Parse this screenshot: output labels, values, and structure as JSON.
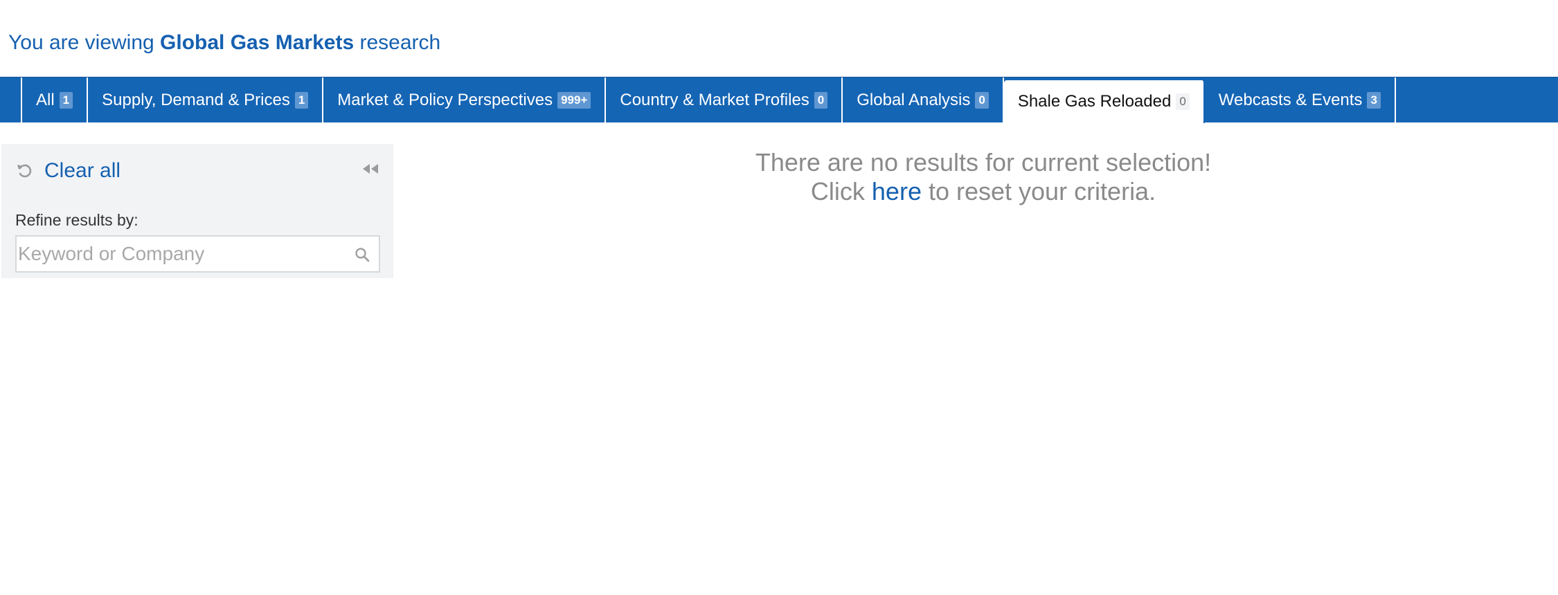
{
  "heading": {
    "prefix": "You are viewing ",
    "emphasis": "Global Gas Markets",
    "suffix": " research"
  },
  "tabs": [
    {
      "label": "All",
      "count": "1",
      "active": false
    },
    {
      "label": "Supply, Demand & Prices",
      "count": "1",
      "active": false
    },
    {
      "label": "Market & Policy Perspectives",
      "count": "999+",
      "active": false
    },
    {
      "label": "Country & Market Profiles",
      "count": "0",
      "active": false
    },
    {
      "label": "Global Analysis",
      "count": "0",
      "active": false
    },
    {
      "label": "Shale Gas Reloaded",
      "count": "0",
      "active": true
    },
    {
      "label": "Webcasts & Events",
      "count": "3",
      "active": false
    }
  ],
  "sidebar": {
    "clear_all_label": "Clear all",
    "refresh_icon": "refresh-icon",
    "collapse_icon": "double-chevron-left-icon",
    "refine_label": "Refine results by:",
    "search_placeholder": "Keyword or Company",
    "search_value": "",
    "search_icon": "search-icon"
  },
  "no_results": {
    "line1": "There are no results for current selection!",
    "line2_prefix": "Click ",
    "line2_link": "here",
    "line2_suffix": " to reset your criteria."
  },
  "colors": {
    "brand_blue": "#1565b5",
    "link_blue": "#1560b0",
    "badge_blue": "#5f97d2",
    "sidebar_bg": "#f1f3f5",
    "muted_text": "#8a8a8a"
  }
}
